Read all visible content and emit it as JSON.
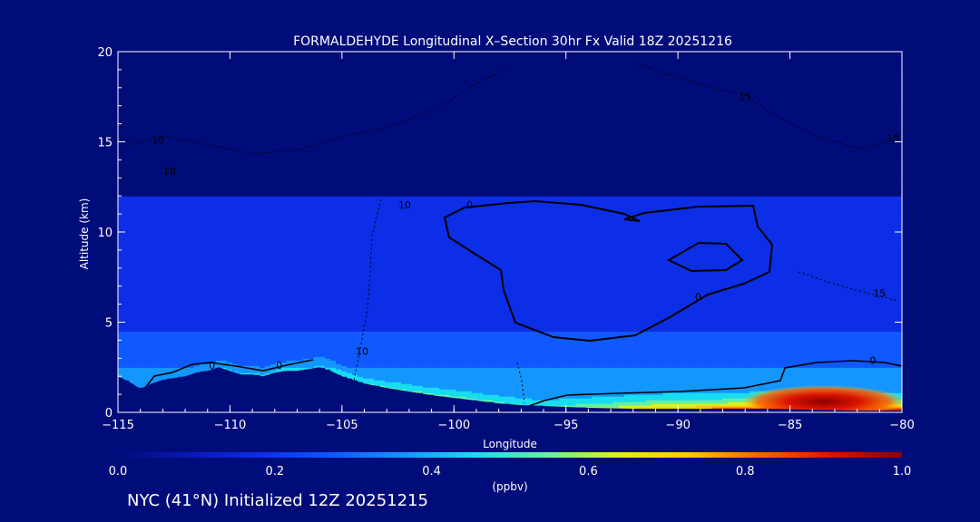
{
  "chart_data": {
    "type": "heatmap",
    "title": "FORMALDEHYDE Longitudinal X–Section 30hr  Fx Valid 18Z 20251216",
    "xlabel": "Longitude",
    "ylabel": "Altitude (km)",
    "xlim": [
      -115,
      -80
    ],
    "ylim": [
      0,
      20
    ],
    "x_ticks": [
      -115,
      -110,
      -105,
      -100,
      -95,
      -90,
      -85,
      -80
    ],
    "x_tick_labels": [
      "−115",
      "−110",
      "−105",
      "−100",
      "−95",
      "−90",
      "−85",
      "−80"
    ],
    "y_ticks": [
      0,
      5,
      10,
      15,
      20
    ],
    "y_tick_labels": [
      "0",
      "5",
      "10",
      "15",
      "20"
    ],
    "colorbar": {
      "label": "(ppbv)",
      "range": [
        0.0,
        1.0
      ],
      "ticks": [
        0.0,
        0.2,
        0.4,
        0.6,
        0.8,
        1.0
      ],
      "tick_labels": [
        "0.0",
        "0.2",
        "0.4",
        "0.6",
        "0.8",
        "1.0"
      ],
      "colors": [
        "#000c7a",
        "#0a18b4",
        "#0c2ee6",
        "#1058ff",
        "#1496ff",
        "#18dcf0",
        "#64f0a0",
        "#dcf020",
        "#ffc800",
        "#ff6400",
        "#dc1400",
        "#8c0000"
      ]
    },
    "levels": [
      0.0,
      0.02,
      0.05,
      0.09,
      0.13,
      0.2,
      0.3,
      0.42,
      0.55,
      0.7,
      0.85,
      1.0
    ],
    "terrain": [
      [
        -115,
        2.0
      ],
      [
        -114.5,
        1.7
      ],
      [
        -114,
        1.3
      ],
      [
        -113.5,
        1.6
      ],
      [
        -113,
        1.8
      ],
      [
        -112.5,
        1.9
      ],
      [
        -112,
        2.0
      ],
      [
        -111.5,
        2.2
      ],
      [
        -111,
        2.3
      ],
      [
        -110.5,
        2.5
      ],
      [
        -110,
        2.3
      ],
      [
        -109.5,
        2.1
      ],
      [
        -109,
        2.1
      ],
      [
        -108.5,
        2.0
      ],
      [
        -108,
        2.2
      ],
      [
        -107.5,
        2.3
      ],
      [
        -107,
        2.3
      ],
      [
        -106.5,
        2.4
      ],
      [
        -106,
        2.5
      ],
      [
        -105.5,
        2.3
      ],
      [
        -105,
        2.0
      ],
      [
        -104,
        1.6
      ],
      [
        -103,
        1.35
      ],
      [
        -102,
        1.15
      ],
      [
        -101,
        0.95
      ],
      [
        -100,
        0.8
      ],
      [
        -99,
        0.65
      ],
      [
        -98,
        0.5
      ],
      [
        -97,
        0.4
      ],
      [
        -96,
        0.35
      ],
      [
        -95,
        0.3
      ],
      [
        -94,
        0.25
      ],
      [
        -92,
        0.2
      ],
      [
        -90,
        0.2
      ],
      [
        -88,
        0.2
      ],
      [
        -86,
        0.2
      ],
      [
        -84,
        0.15
      ],
      [
        -82,
        0.1
      ],
      [
        -80,
        0.1
      ]
    ],
    "contour_labels": [
      {
        "text": "0",
        "x": -110.8,
        "y": 2.4
      },
      {
        "text": "0",
        "x": -107.8,
        "y": 2.4
      },
      {
        "text": "0",
        "x": -99.3,
        "y": 11.3
      },
      {
        "text": "0",
        "x": -89.1,
        "y": 6.2
      },
      {
        "text": "0",
        "x": -81.3,
        "y": 2.7
      },
      {
        "text": "10",
        "x": -102.2,
        "y": 11.3
      },
      {
        "text": "10",
        "x": -104.1,
        "y": 3.2
      },
      {
        "text": "10",
        "x": -113.2,
        "y": 14.9
      },
      {
        "text": "10",
        "x": -112.7,
        "y": 13.2
      },
      {
        "text": "15",
        "x": -81.0,
        "y": 6.4
      },
      {
        "text": "15",
        "x": -80.4,
        "y": 15.0
      },
      {
        "text": "15",
        "x": -87.0,
        "y": 17.3
      }
    ]
  },
  "footer": "NYC (41°N) Initialized 12Z 20251215"
}
